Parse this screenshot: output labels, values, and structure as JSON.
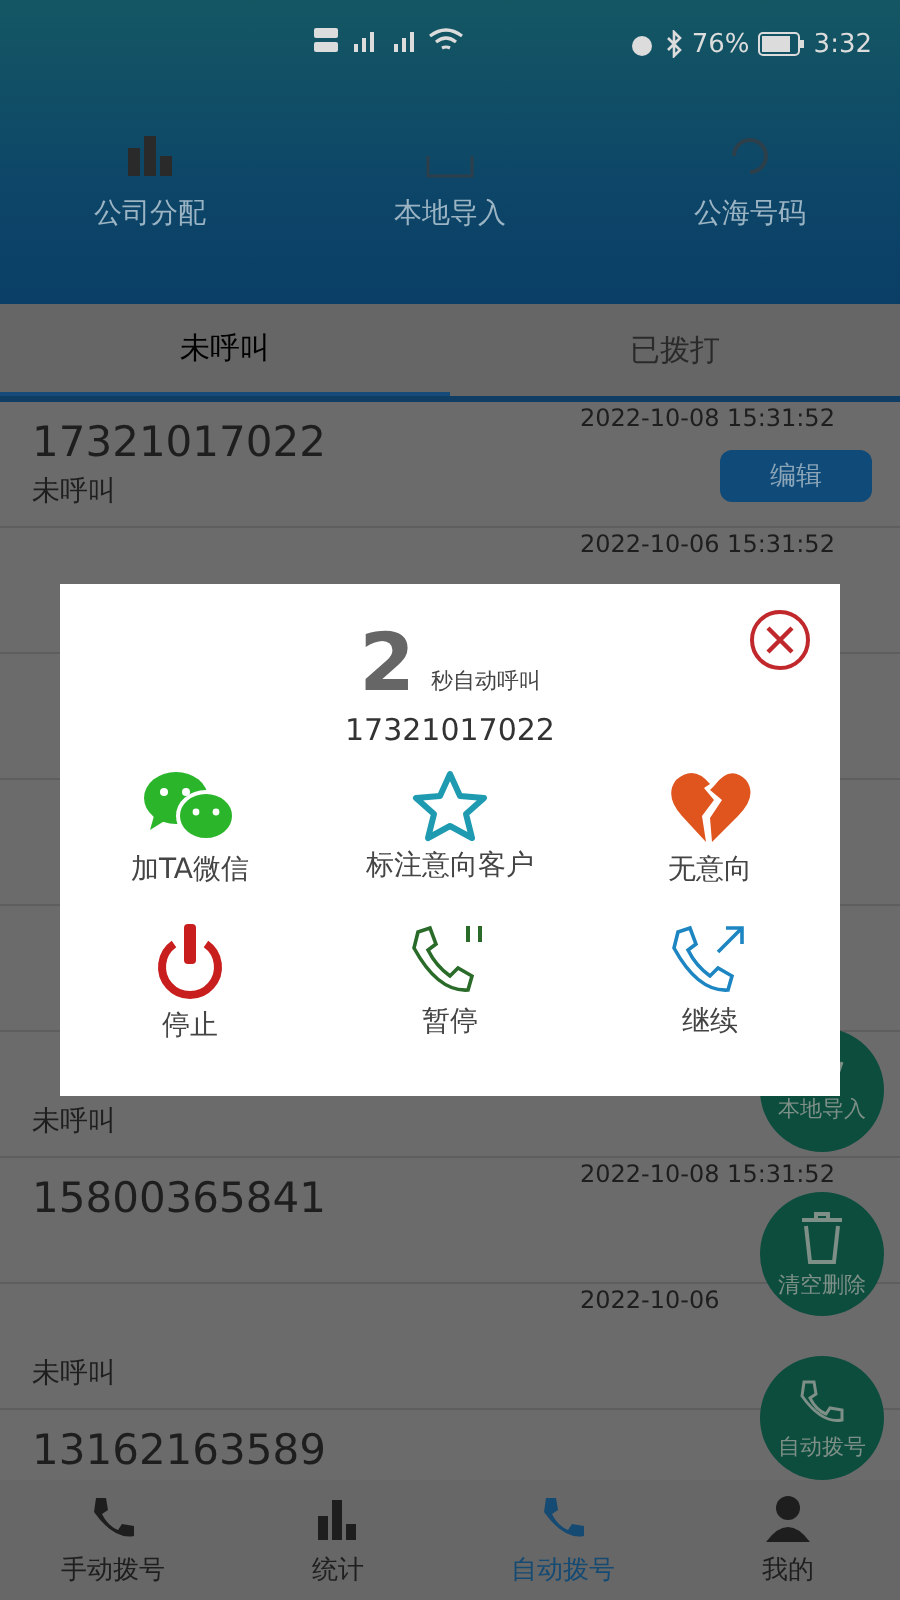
{
  "status_bar": {
    "battery": "76%",
    "time": "3:32"
  },
  "header_actions": [
    {
      "label": "公司分配",
      "kind": "building"
    },
    {
      "label": "本地导入",
      "kind": "import"
    },
    {
      "label": "公海号码",
      "kind": "refresh"
    }
  ],
  "tabs": [
    {
      "label": "未呼叫",
      "selected": true
    },
    {
      "label": "已拨打",
      "selected": false
    }
  ],
  "rows": [
    {
      "number": "17321017022",
      "status": "未呼叫",
      "date": "2022-10-08 15:31:52",
      "edit": "编辑"
    },
    {
      "date": "2022-10-06 15:31:52"
    },
    {},
    {},
    {},
    {
      "status": "未呼叫"
    },
    {
      "number": "15800365841",
      "date": "2022-10-08 15:31:52"
    },
    {
      "status": "未呼叫",
      "date": "2022-10-06"
    },
    {
      "number": "13162163589"
    }
  ],
  "fabs": [
    {
      "label": "本地导入",
      "kind": "import"
    },
    {
      "label": "清空删除",
      "kind": "trash"
    },
    {
      "label": "自动拨号",
      "kind": "phone"
    }
  ],
  "bottom_nav": [
    {
      "label": "手动拨号",
      "kind": "phone",
      "selected": false
    },
    {
      "label": "统计",
      "kind": "chart",
      "selected": false
    },
    {
      "label": "自动拨号",
      "kind": "autodial",
      "selected": true
    },
    {
      "label": "我的",
      "kind": "person",
      "selected": false
    }
  ],
  "dialog": {
    "countdown": "2",
    "countdown_label": "秒自动呼叫",
    "number": "17321017022",
    "actions": [
      {
        "label": "加TA微信",
        "kind": "wechat"
      },
      {
        "label": "标注意向客户",
        "kind": "star"
      },
      {
        "label": "无意向",
        "kind": "broken-heart"
      },
      {
        "label": "停止",
        "kind": "power"
      },
      {
        "label": "暂停",
        "kind": "pause-call"
      },
      {
        "label": "继续",
        "kind": "resume-call"
      }
    ]
  }
}
